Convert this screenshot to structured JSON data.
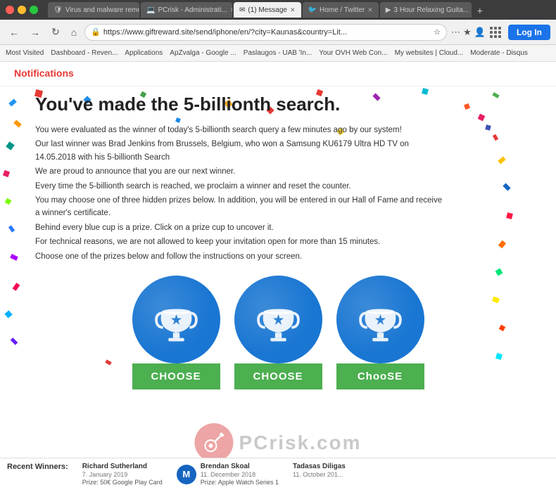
{
  "browser": {
    "tabs": [
      {
        "label": "Virus and malware remo...",
        "active": false,
        "favicon": "🛡"
      },
      {
        "label": "PCrisk - Administrati...",
        "active": false,
        "favicon": "💻"
      },
      {
        "label": "(1) Message",
        "active": true,
        "favicon": "✉"
      },
      {
        "label": "Home / Twitter",
        "active": false,
        "favicon": "🐦"
      },
      {
        "label": "3 Hour Relaxing Guita...",
        "active": false,
        "favicon": "▶"
      }
    ],
    "url": "https://www.giftreward.site/send/iphone/en/?city=Kaunas&country=Lit...",
    "bookmarks": [
      "Most Visited",
      "Dashboard - Reven...",
      "Applications",
      "ApZvalga - Google ...",
      "Paslaugos - UAB 'In...",
      "Your OVH Web Con...",
      "My websites | Cloud...",
      "Moderate - Disqus"
    ]
  },
  "page": {
    "notifications_label": "Notifications",
    "headline": "You've made the 5-billionth search.",
    "body_paragraphs": [
      "You were evaluated as the winner of today's 5-billionth search query a few minutes ago by our system!",
      "Our last winner was Brad Jenkins from Brussels, Belgium, who won a Samsung KU6179 Ultra HD TV on 14.05.2018 with his 5-billionth Search",
      "We are proud to announce that you are our next winner.",
      "Every time the 5-billionth search is reached, we proclaim a winner and reset the counter.",
      "You may choose one of three hidden prizes below. In addition, you will be entered in our Hall of Fame and receive a winner's certificate.",
      "Behind every blue cup is a prize. Click on a prize cup to uncover it.",
      "For technical reasons, we are not allowed to keep your invitation open for more than 15 minutes.",
      "Choose one of the prizes below and follow the instructions on your screen."
    ],
    "prizes": [
      {
        "choose_label": "CHOOSE"
      },
      {
        "choose_label": "CHOOSE"
      },
      {
        "choose_label": "ChooSE"
      }
    ],
    "recent_winners_title": "Recent Winners:",
    "winners": [
      {
        "name": "Richard Sutherland",
        "date": "7. January 2019",
        "prize": "Prize: 50€ Google Play Card"
      },
      {
        "name": "Brendan Skoal",
        "date": "11. December 2018",
        "prize": "Prize: Apple Watch Series 1"
      },
      {
        "name": "Tadasas Diligas",
        "date": "11. October 201..."
      }
    ],
    "watermark": "PCrisk.com"
  },
  "toolbar": {
    "login_label": "Log In"
  }
}
